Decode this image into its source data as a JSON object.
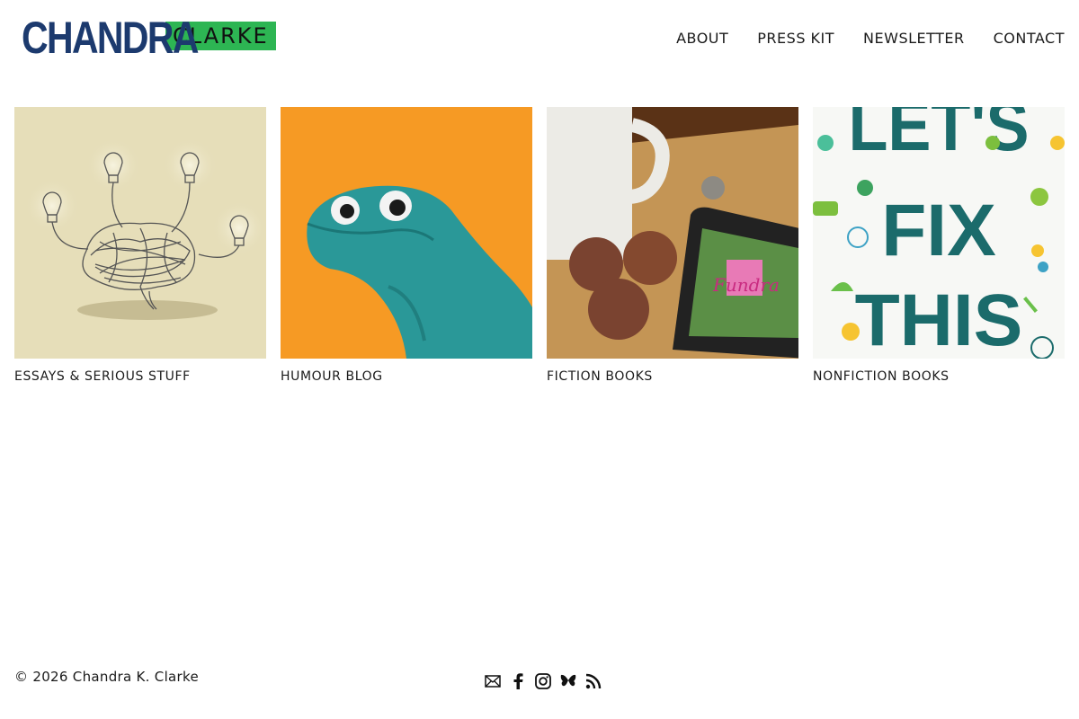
{
  "header": {
    "logo_first": "CHANDRA",
    "logo_last": "CLARKE",
    "nav": [
      "ABOUT",
      "PRESS KIT",
      "NEWSLETTER",
      "CONTACT"
    ]
  },
  "tiles": [
    {
      "label": "ESSAYS & SERIOUS STUFF",
      "image": "brain-lightbulbs-illustration"
    },
    {
      "label": "HUMOUR BLOG",
      "image": "teal-sock-puppet"
    },
    {
      "label": "FICTION BOOKS",
      "image": "coffee-muffins-ereader"
    },
    {
      "label": "NONFICTION BOOKS",
      "image": "lets-fix-this-book-cover",
      "cover_text": "LET'S FIX THIS"
    }
  ],
  "footer": {
    "copyright": "© 2026 Chandra K. Clarke",
    "social": [
      "email-icon",
      "facebook-icon",
      "instagram-icon",
      "bluesky-icon",
      "rss-icon"
    ]
  },
  "colors": {
    "logo_blue": "#1c3a6e",
    "logo_green": "#2db553",
    "teal": "#1b6b6b"
  }
}
